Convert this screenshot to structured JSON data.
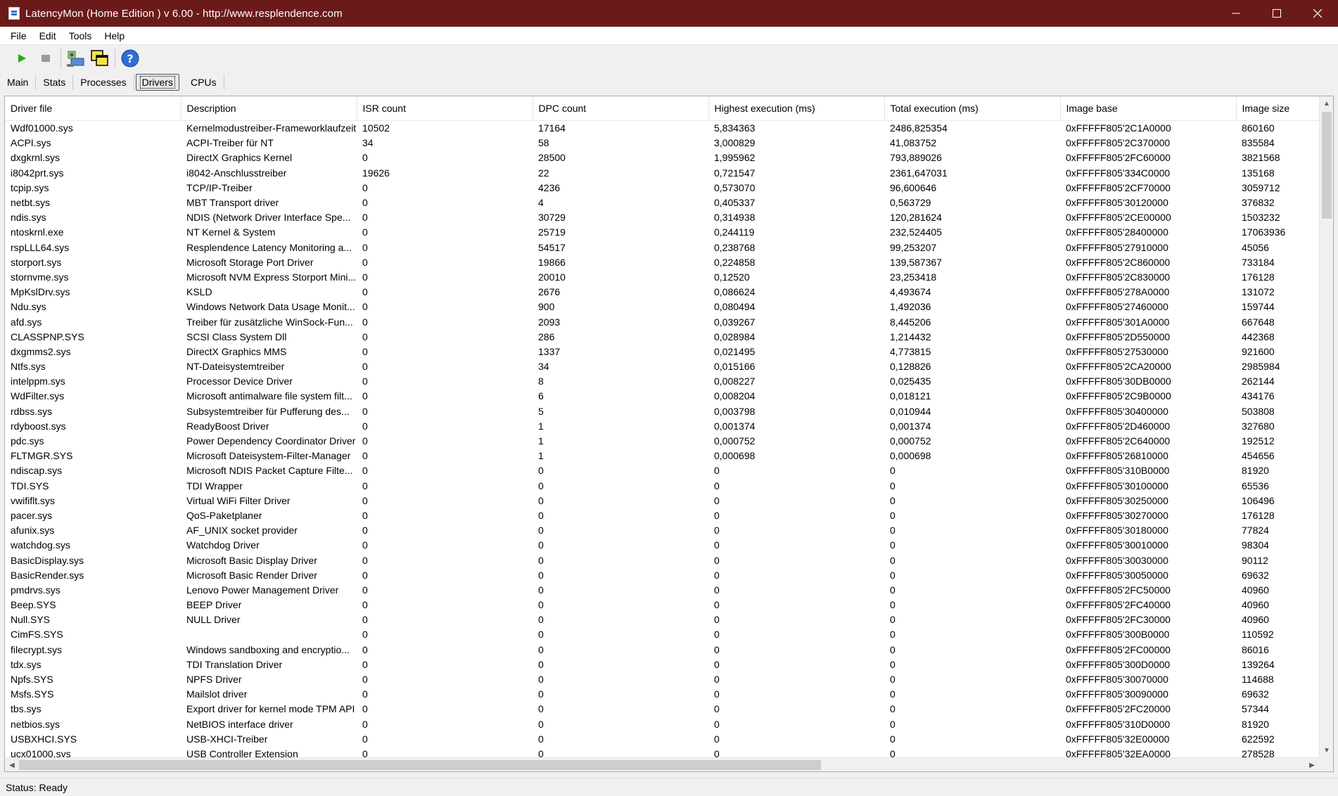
{
  "window": {
    "title": "LatencyMon  (Home Edition )  v 6.00 - http://www.resplendence.com",
    "minimize_glyph": "—",
    "maximize_glyph": "☐",
    "close_glyph": "✕"
  },
  "menu": [
    "File",
    "Edit",
    "Tools",
    "Help"
  ],
  "toolbar": {
    "icons": [
      "play-icon",
      "stop-icon",
      "driver-tool-icon",
      "copy-windows-icon",
      "help-icon"
    ],
    "accent": "#1fae1f"
  },
  "tabs": [
    {
      "label": "Main",
      "active": false
    },
    {
      "label": "Stats",
      "active": false
    },
    {
      "label": "Processes",
      "active": false
    },
    {
      "label": "Drivers",
      "active": true
    },
    {
      "label": "CPUs",
      "active": false
    }
  ],
  "grid": {
    "columns": [
      "Driver file",
      "Description",
      "ISR count",
      "DPC count",
      "Highest execution (ms)",
      "Total execution (ms)",
      "Image base",
      "Image size"
    ],
    "rows": [
      [
        "Wdf01000.sys",
        "Kernelmodustreiber-Frameworklaufzeit",
        "10502",
        "17164",
        "5,834363",
        "2486,825354",
        "0xFFFFF805'2C1A0000",
        "860160"
      ],
      [
        "ACPI.sys",
        "ACPI-Treiber für NT",
        "34",
        "58",
        "3,000829",
        "41,083752",
        "0xFFFFF805'2C370000",
        "835584"
      ],
      [
        "dxgkrnl.sys",
        "DirectX Graphics Kernel",
        "0",
        "28500",
        "1,995962",
        "793,889026",
        "0xFFFFF805'2FC60000",
        "3821568"
      ],
      [
        "i8042prt.sys",
        "i8042-Anschlusstreiber",
        "19626",
        "22",
        "0,721547",
        "2361,647031",
        "0xFFFFF805'334C0000",
        "135168"
      ],
      [
        "tcpip.sys",
        "TCP/IP-Treiber",
        "0",
        "4236",
        "0,573070",
        "96,600646",
        "0xFFFFF805'2CF70000",
        "3059712"
      ],
      [
        "netbt.sys",
        "MBT Transport driver",
        "0",
        "4",
        "0,405337",
        "0,563729",
        "0xFFFFF805'30120000",
        "376832"
      ],
      [
        "ndis.sys",
        "NDIS (Network Driver Interface Spe...",
        "0",
        "30729",
        "0,314938",
        "120,281624",
        "0xFFFFF805'2CE00000",
        "1503232"
      ],
      [
        "ntoskrnl.exe",
        "NT Kernel & System",
        "0",
        "25719",
        "0,244119",
        "232,524405",
        "0xFFFFF805'28400000",
        "17063936"
      ],
      [
        "rspLLL64.sys",
        "Resplendence Latency Monitoring a...",
        "0",
        "54517",
        "0,238768",
        "99,253207",
        "0xFFFFF805'27910000",
        "45056"
      ],
      [
        "storport.sys",
        "Microsoft Storage Port Driver",
        "0",
        "19866",
        "0,224858",
        "139,587367",
        "0xFFFFF805'2C860000",
        "733184"
      ],
      [
        "stornvme.sys",
        "Microsoft NVM Express Storport Mini...",
        "0",
        "20010",
        "0,12520",
        "23,253418",
        "0xFFFFF805'2C830000",
        "176128"
      ],
      [
        "MpKslDrv.sys",
        "KSLD",
        "0",
        "2676",
        "0,086624",
        "4,493674",
        "0xFFFFF805'278A0000",
        "131072"
      ],
      [
        "Ndu.sys",
        "Windows Network Data Usage Monit...",
        "0",
        "900",
        "0,080494",
        "1,492036",
        "0xFFFFF805'27460000",
        "159744"
      ],
      [
        "afd.sys",
        "Treiber für zusätzliche WinSock-Fun...",
        "0",
        "2093",
        "0,039267",
        "8,445206",
        "0xFFFFF805'301A0000",
        "667648"
      ],
      [
        "CLASSPNP.SYS",
        "SCSI Class System Dll",
        "0",
        "286",
        "0,028984",
        "1,214432",
        "0xFFFFF805'2D550000",
        "442368"
      ],
      [
        "dxgmms2.sys",
        "DirectX Graphics MMS",
        "0",
        "1337",
        "0,021495",
        "4,773815",
        "0xFFFFF805'27530000",
        "921600"
      ],
      [
        "Ntfs.sys",
        "NT-Dateisystemtreiber",
        "0",
        "34",
        "0,015166",
        "0,128826",
        "0xFFFFF805'2CA20000",
        "2985984"
      ],
      [
        "intelppm.sys",
        "Processor Device Driver",
        "0",
        "8",
        "0,008227",
        "0,025435",
        "0xFFFFF805'30DB0000",
        "262144"
      ],
      [
        "WdFilter.sys",
        "Microsoft antimalware file system filt...",
        "0",
        "6",
        "0,008204",
        "0,018121",
        "0xFFFFF805'2C9B0000",
        "434176"
      ],
      [
        "rdbss.sys",
        "Subsystemtreiber für Pufferung des...",
        "0",
        "5",
        "0,003798",
        "0,010944",
        "0xFFFFF805'30400000",
        "503808"
      ],
      [
        "rdyboost.sys",
        "ReadyBoost Driver",
        "0",
        "1",
        "0,001374",
        "0,001374",
        "0xFFFFF805'2D460000",
        "327680"
      ],
      [
        "pdc.sys",
        "Power Dependency Coordinator Driver",
        "0",
        "1",
        "0,000752",
        "0,000752",
        "0xFFFFF805'2C640000",
        "192512"
      ],
      [
        "FLTMGR.SYS",
        "Microsoft Dateisystem-Filter-Manager",
        "0",
        "1",
        "0,000698",
        "0,000698",
        "0xFFFFF805'26810000",
        "454656"
      ],
      [
        "ndiscap.sys",
        "Microsoft NDIS Packet Capture Filte...",
        "0",
        "0",
        "0",
        "0",
        "0xFFFFF805'310B0000",
        "81920"
      ],
      [
        "TDI.SYS",
        "TDI Wrapper",
        "0",
        "0",
        "0",
        "0",
        "0xFFFFF805'30100000",
        "65536"
      ],
      [
        "vwififlt.sys",
        "Virtual WiFi Filter Driver",
        "0",
        "0",
        "0",
        "0",
        "0xFFFFF805'30250000",
        "106496"
      ],
      [
        "pacer.sys",
        "QoS-Paketplaner",
        "0",
        "0",
        "0",
        "0",
        "0xFFFFF805'30270000",
        "176128"
      ],
      [
        "afunix.sys",
        "AF_UNIX socket provider",
        "0",
        "0",
        "0",
        "0",
        "0xFFFFF805'30180000",
        "77824"
      ],
      [
        "watchdog.sys",
        "Watchdog Driver",
        "0",
        "0",
        "0",
        "0",
        "0xFFFFF805'30010000",
        "98304"
      ],
      [
        "BasicDisplay.sys",
        "Microsoft Basic Display Driver",
        "0",
        "0",
        "0",
        "0",
        "0xFFFFF805'30030000",
        "90112"
      ],
      [
        "BasicRender.sys",
        "Microsoft Basic Render Driver",
        "0",
        "0",
        "0",
        "0",
        "0xFFFFF805'30050000",
        "69632"
      ],
      [
        "pmdrvs.sys",
        "Lenovo Power Management Driver",
        "0",
        "0",
        "0",
        "0",
        "0xFFFFF805'2FC50000",
        "40960"
      ],
      [
        "Beep.SYS",
        "BEEP Driver",
        "0",
        "0",
        "0",
        "0",
        "0xFFFFF805'2FC40000",
        "40960"
      ],
      [
        "Null.SYS",
        "NULL Driver",
        "0",
        "0",
        "0",
        "0",
        "0xFFFFF805'2FC30000",
        "40960"
      ],
      [
        "CimFS.SYS",
        "",
        "0",
        "0",
        "0",
        "0",
        "0xFFFFF805'300B0000",
        "110592"
      ],
      [
        "filecrypt.sys",
        "Windows sandboxing and encryptio...",
        "0",
        "0",
        "0",
        "0",
        "0xFFFFF805'2FC00000",
        "86016"
      ],
      [
        "tdx.sys",
        "TDI Translation Driver",
        "0",
        "0",
        "0",
        "0",
        "0xFFFFF805'300D0000",
        "139264"
      ],
      [
        "Npfs.SYS",
        "NPFS Driver",
        "0",
        "0",
        "0",
        "0",
        "0xFFFFF805'30070000",
        "114688"
      ],
      [
        "Msfs.SYS",
        "Mailslot driver",
        "0",
        "0",
        "0",
        "0",
        "0xFFFFF805'30090000",
        "69632"
      ],
      [
        "tbs.sys",
        "Export driver for kernel mode TPM API",
        "0",
        "0",
        "0",
        "0",
        "0xFFFFF805'2FC20000",
        "57344"
      ],
      [
        "netbios.sys",
        "NetBIOS interface driver",
        "0",
        "0",
        "0",
        "0",
        "0xFFFFF805'310D0000",
        "81920"
      ],
      [
        "USBXHCI.SYS",
        "USB-XHCI-Treiber",
        "0",
        "0",
        "0",
        "0",
        "0xFFFFF805'32E00000",
        "622592"
      ],
      [
        "ucx01000.sys",
        "USB Controller Extension",
        "0",
        "0",
        "0",
        "0",
        "0xFFFFF805'32EA0000",
        "278528"
      ]
    ]
  },
  "status": {
    "text": "Status: Ready"
  }
}
